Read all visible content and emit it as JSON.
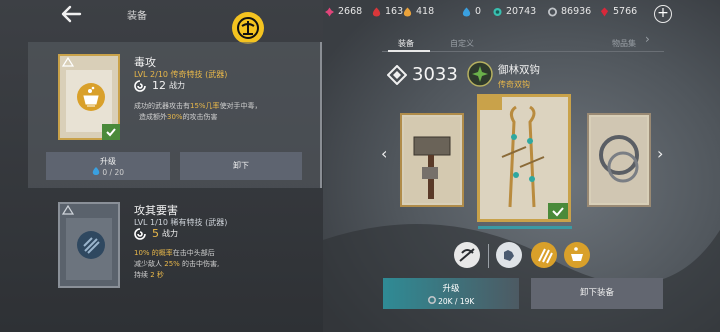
{
  "header": {
    "title": "装备",
    "resources": [
      {
        "icon": "pink-gem-icon",
        "value": "2668",
        "color": "#e0457a"
      },
      {
        "icon": "red-flame-icon",
        "value": "163",
        "color": "#d9373a"
      },
      {
        "icon": "orange-flame-icon",
        "value": "418",
        "color": "#e9a23b"
      },
      {
        "icon": "blue-flame-icon",
        "value": "0",
        "color": "#3aa0e0"
      },
      {
        "icon": "teal-coin-icon",
        "value": "20743",
        "color": "#38c0b0"
      },
      {
        "icon": "grey-ring-icon",
        "value": "86936",
        "color": "#c0c4c8"
      },
      {
        "icon": "red-crystal-icon",
        "value": "5766",
        "color": "#d8283a"
      }
    ]
  },
  "skills": [
    {
      "name": "毒攻",
      "level": "LVL 2/10 传奇特技 (武器)",
      "power_value": "12",
      "power_label": "战力",
      "desc_parts": [
        [
          "成功的武器攻击有",
          false
        ],
        [
          "15%几率",
          true
        ],
        [
          "使对手中毒，",
          false
        ]
      ],
      "desc_line2": [
        [
          "造成额外",
          false
        ],
        [
          "30%",
          true
        ],
        [
          "的攻击伤害",
          false
        ]
      ],
      "upgrade_label": "升级",
      "upgrade_cost": "0 / 20",
      "unequip_label": "卸下"
    },
    {
      "name": "攻其要害",
      "level": "LVL 1/10 稀有特技 (武器)",
      "power_value": "5",
      "power_label": "战力",
      "desc_line1": [
        [
          "10% 的概率",
          true
        ],
        [
          "在击中头部后",
          false
        ]
      ],
      "desc_line2": [
        [
          "减少敌人 ",
          false
        ],
        [
          "25%",
          true
        ],
        [
          " 的击中伤害,",
          false
        ]
      ],
      "desc_line3": [
        [
          "持续 ",
          false
        ],
        [
          "2 秒",
          true
        ]
      ]
    }
  ],
  "tabs": [
    {
      "label": "装备",
      "active": true
    },
    {
      "label": "自定义",
      "active": false
    },
    {
      "label": "物品集",
      "active": false
    }
  ],
  "weapon": {
    "score": "3033",
    "name": "御林双钩",
    "type": "传奇双钩"
  },
  "actions": {
    "upgrade_label": "升级",
    "upgrade_cost": "20K / 19K",
    "unequip_label": "卸下装备"
  },
  "colors": {
    "accent_gold": "#e9b84a",
    "legendary_border": "#c9a24a",
    "teal": "#2f8b95"
  }
}
